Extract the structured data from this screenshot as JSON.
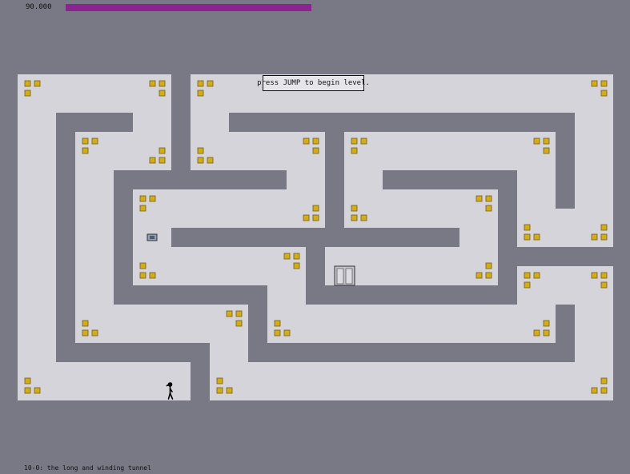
{
  "hud": {
    "time_value": "90.000",
    "time_remaining_fraction": 1.0,
    "time_bar_color": "#8c2490"
  },
  "prompt": {
    "text": "press JUMP to begin level."
  },
  "level": {
    "name": "10-0: the long and winding tunnel"
  },
  "colors": {
    "background": "#797985",
    "floor": "#d4d4da",
    "gold": "#d2ac1a",
    "gold_border": "#7a5f00"
  },
  "icons": {
    "gold": "gold-icon",
    "player": "ninja-icon",
    "exit": "exit-door-icon",
    "switch": "exit-switch-icon"
  }
}
